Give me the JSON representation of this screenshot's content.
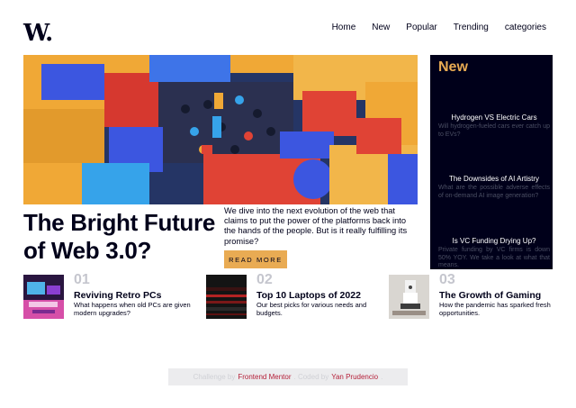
{
  "header": {
    "logo": "W.",
    "nav": [
      "Home",
      "New",
      "Popular",
      "Trending",
      "categories"
    ]
  },
  "hero": {
    "headline": "The Bright Future of Web 3.0?",
    "lead": "We dive into the next evolution of the web that claims to put the power of the platforms back into the hands of the people. But is it really fulfilling its promise?",
    "cta": "READ MORE"
  },
  "new_panel": {
    "title": "New",
    "items": [
      {
        "title": "Hydrogen VS Electric Cars",
        "desc": "Will hydrogen-fueled cars ever catch up to EVs?"
      },
      {
        "title": "The Downsides of AI Artistry",
        "desc": "What are the possible adverse effects of on-demand AI image generation?"
      },
      {
        "title": "Is VC Funding Drying Up?",
        "desc": "Private funding by VC firms is down 50% YOY. We take a look at what that means."
      }
    ]
  },
  "cards": [
    {
      "num": "01",
      "title": "Reviving Retro PCs",
      "desc": "What happens when old PCs are given modern upgrades?"
    },
    {
      "num": "02",
      "title": "Top 10 Laptops of 2022",
      "desc": "Our best picks for various needs and budgets."
    },
    {
      "num": "03",
      "title": "The Growth of Gaming",
      "desc": "How the pandemic has sparked fresh opportunities."
    }
  ],
  "footer": {
    "prefix": "Challenge by",
    "mentor": "Frontend Mentor",
    "mid": ". Coded by",
    "author": "Yan Prudencio",
    "suffix": "."
  },
  "colors": {
    "accent": "#e9ab53",
    "dark": "#00001a",
    "link": "#b5213a",
    "muted": "#c5c6ce"
  }
}
